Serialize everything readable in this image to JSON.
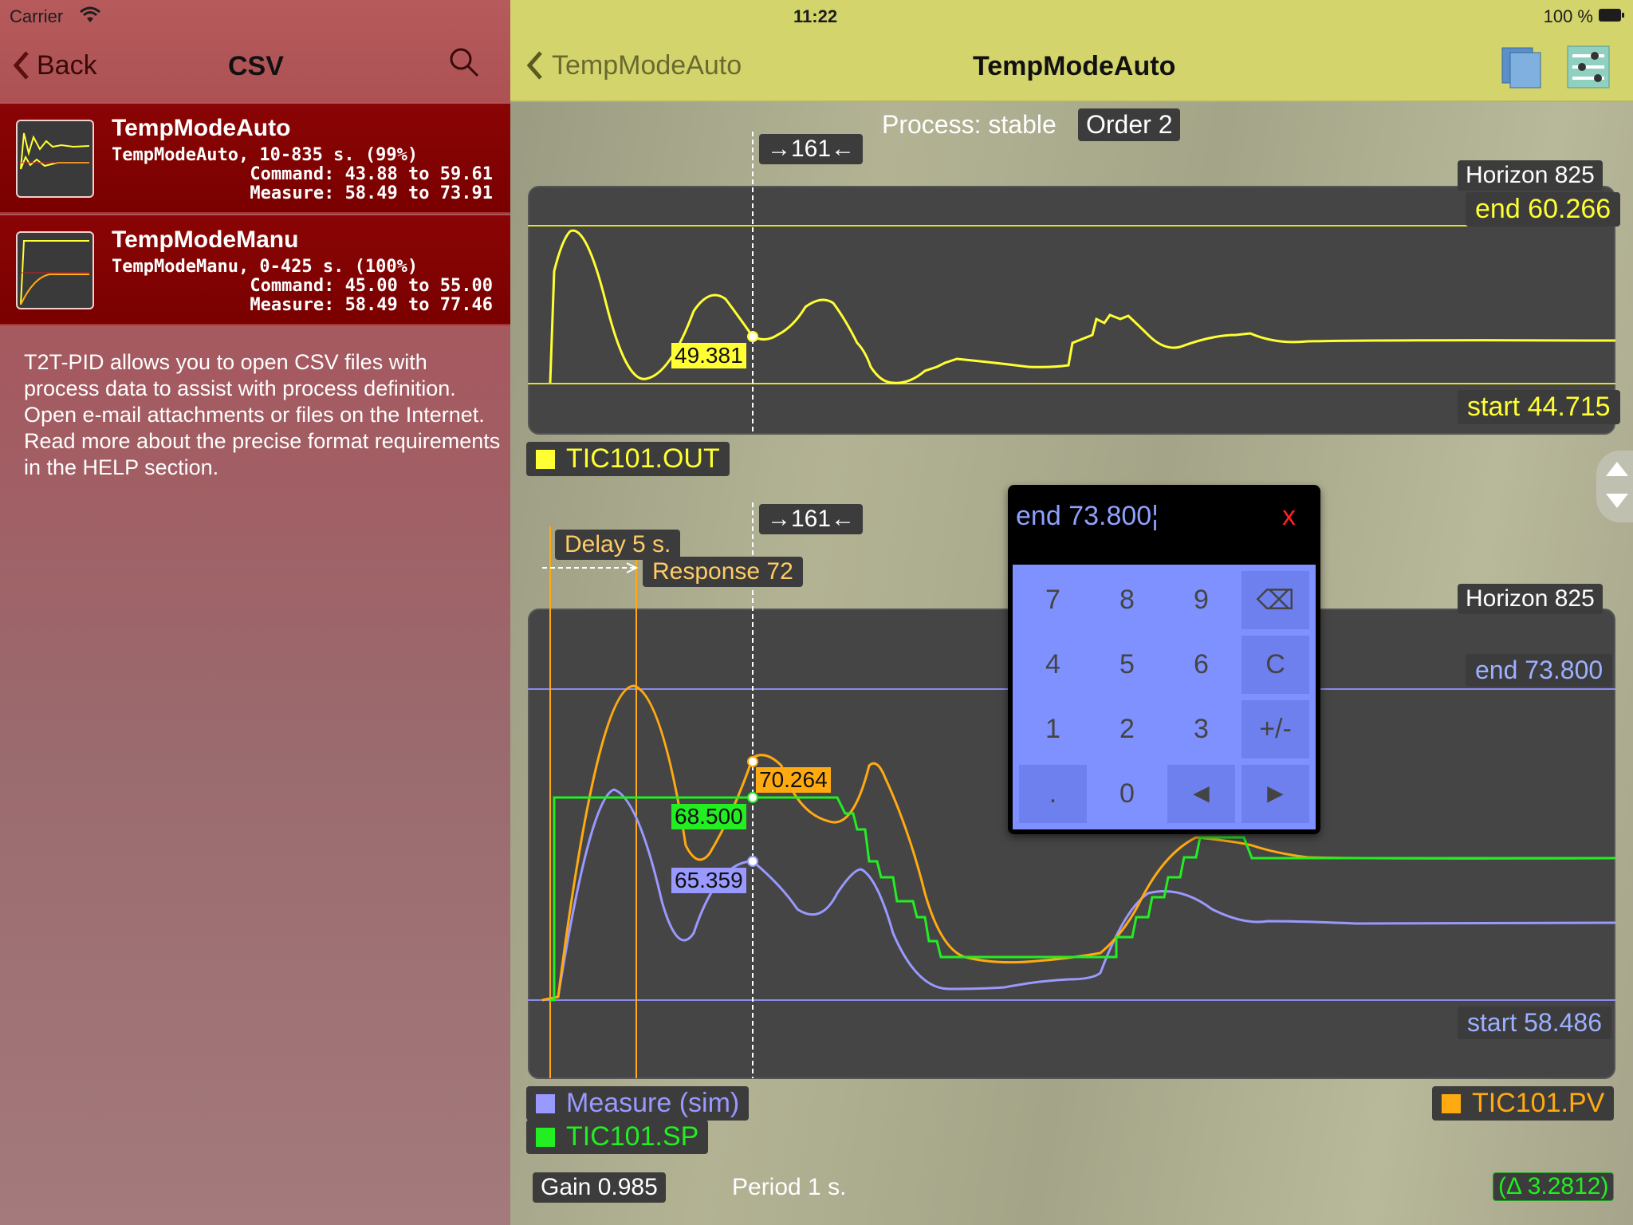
{
  "status_bar": {
    "carrier": "Carrier",
    "time": "11:22",
    "battery": "100 %"
  },
  "left_nav": {
    "back_label": "Back",
    "title": "CSV"
  },
  "files": [
    {
      "title": "TempModeAuto",
      "line1": "TempModeAuto, 10-835 s. (99%)",
      "line2": "Command: 43.88 to 59.61",
      "line3": "Measure: 58.49 to 73.91"
    },
    {
      "title": "TempModeManu",
      "line1": "TempModeManu, 0-425 s. (100%)",
      "line2": "Command: 45.00 to 55.00",
      "line3": "Measure: 58.49 to 77.46"
    }
  ],
  "description": "T2T-PID allows you to open CSV files with process data to assist with process definition. Open e-mail attachments or files on the Internet. Read more about the precise format requirements in the HELP section.",
  "right_nav": {
    "back_label": "TempModeAuto",
    "title": "TempModeAuto"
  },
  "process": {
    "status": "Process: stable",
    "order": "Order 2"
  },
  "cursor_label": "→161←",
  "top_chart": {
    "horizon": "Horizon 825",
    "end": "end 60.266",
    "start": "start 44.715",
    "cursor_value": "49.381",
    "legend": "TIC101.OUT",
    "color": "#ffff33"
  },
  "bottom_chart": {
    "horizon": "Horizon 825",
    "end": "end 73.800",
    "start": "start 58.486",
    "delay": "Delay 5 s.",
    "response": "Response 72",
    "pv_value": "70.264",
    "sp_value": "68.500",
    "meas_value": "65.359",
    "legend_meas": "Measure (sim)",
    "legend_sp": "TIC101.SP",
    "legend_pv": "TIC101.PV",
    "colors": {
      "pv": "#ffaa11",
      "sp": "#22ee22",
      "meas": "#9999ff"
    }
  },
  "footer": {
    "gain": "Gain 0.985",
    "period": "Period 1 s.",
    "delta": "(Δ 3.2812)"
  },
  "keypad": {
    "display": "end  73.800¦",
    "close": "x",
    "keys": [
      "7",
      "8",
      "9",
      "⌫",
      "4",
      "5",
      "6",
      "C",
      "1",
      "2",
      "3",
      "+/-",
      ".",
      "0",
      "◄",
      "►"
    ]
  }
}
